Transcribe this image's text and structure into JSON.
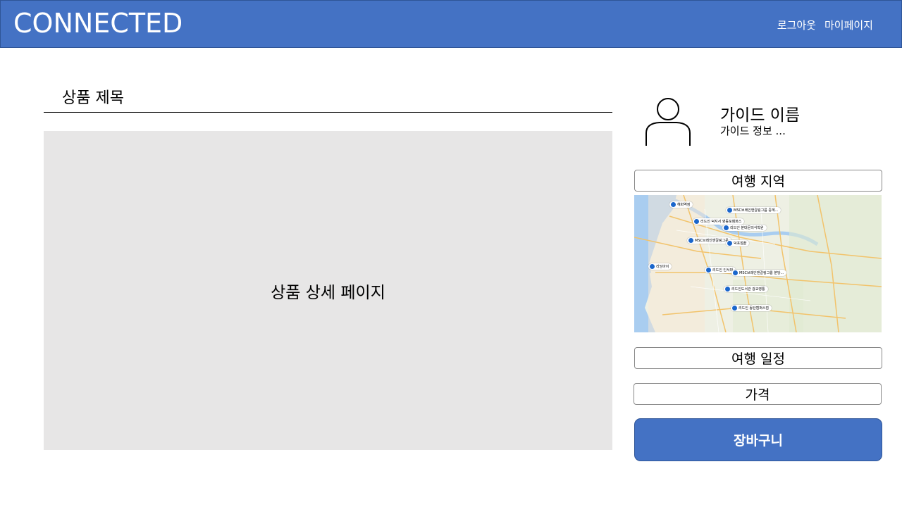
{
  "header": {
    "brand": "CONNECTED",
    "logout_label": "로그아웃",
    "mypage_label": "마이페이지"
  },
  "product": {
    "title": "상품 제목",
    "detail_label": "상품 상세 페이지"
  },
  "guide": {
    "name": "가이드 이름",
    "info": "가이드 정보 ..."
  },
  "fields": {
    "region_label": "여행 지역",
    "schedule_label": "여행 일정",
    "price_label": "가격"
  },
  "cart_label": "장바구니",
  "map_markers": [
    "혜화역점",
    "MSC브레인앤갈링그룹 중계...",
    "리드인 덕지서 영등포캠퍼스",
    "리드인 분대문의식학원",
    "MSC브레인앤갈링그룹",
    "덕포점끝",
    "리딩아이",
    "리드인 인서퍼",
    "MSC브레인앤갈링그룹 분당...",
    "리드인도서관 광교영통",
    "리드인 동탄캠퍼스점"
  ],
  "colors": {
    "header_bg": "#4472c4",
    "detail_bg": "#e7e6e6",
    "cart_bg": "#4472c4"
  }
}
